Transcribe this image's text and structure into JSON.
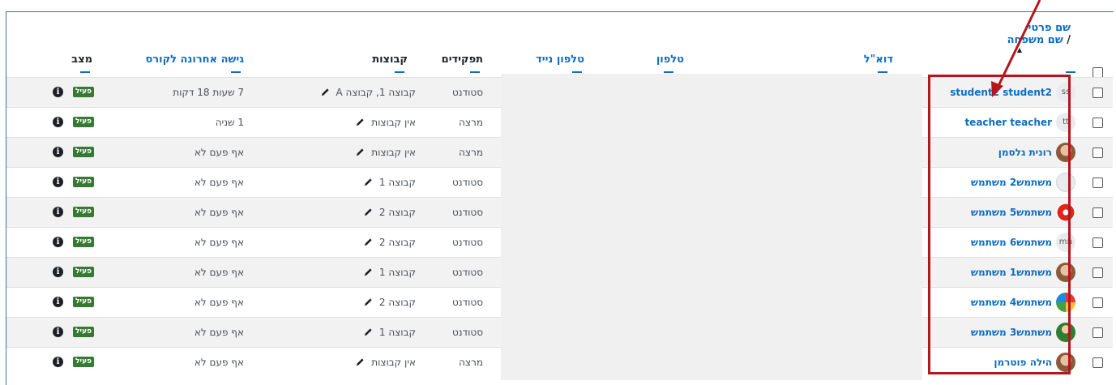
{
  "headers": {
    "name_first": "שם פרטי",
    "name_sep": "/",
    "name_last": "שם משפחה",
    "sort_arrow": "▲",
    "email": "דוא\"ל",
    "phone": "טלפון",
    "mobile": "טלפון נייד",
    "roles": "תפקידים",
    "groups": "קבוצות",
    "last_access": "גישה אחרונה לקורס",
    "status": "מצב"
  },
  "rows": [
    {
      "name": "student2 student2",
      "avatar": "ss",
      "role": "סטודנט",
      "groups": "קבוצה 1, קבוצה A",
      "last_access": "7 שעות 18 דקות",
      "status": "פעיל"
    },
    {
      "name": "teacher teacher",
      "avatar": "tt",
      "role": "מרצה",
      "groups": "אין קבוצות",
      "last_access": "1 שניה",
      "status": "פעיל"
    },
    {
      "name": "רונית גלסמן",
      "avatar": "photo",
      "role": "מרצה",
      "groups": "אין קבוצות",
      "last_access": "אף פעם לא",
      "status": "פעיל"
    },
    {
      "name": "משתמש2 משתמש",
      "avatar": "default",
      "role": "סטודנט",
      "groups": "קבוצה 1",
      "last_access": "אף פעם לא",
      "status": "פעיל"
    },
    {
      "name": "משתמש5 משתמש",
      "avatar": "flower",
      "role": "סטודנט",
      "groups": "קבוצה 2",
      "last_access": "אף פעם לא",
      "status": "פעיל"
    },
    {
      "name": "משתמש6 משתמש",
      "avatar": "מm",
      "role": "סטודנט",
      "groups": "קבוצה 2",
      "last_access": "אף פעם לא",
      "status": "פעיל"
    },
    {
      "name": "משתמש1 משתמש",
      "avatar": "photo",
      "role": "סטודנט",
      "groups": "קבוצה 1",
      "last_access": "אף פעם לא",
      "status": "פעיל"
    },
    {
      "name": "משתמש4 משתמש",
      "avatar": "balloons",
      "role": "סטודנט",
      "groups": "קבוצה 2",
      "last_access": "אף פעם לא",
      "status": "פעיל"
    },
    {
      "name": "משתמש3 משתמש",
      "avatar": "people",
      "role": "סטודנט",
      "groups": "קבוצה 1",
      "last_access": "אף פעם לא",
      "status": "פעיל"
    },
    {
      "name": "הילה פוטרמן",
      "avatar": "photo",
      "role": "מרצה",
      "groups": "אין קבוצות",
      "last_access": "אף פעם לא",
      "status": "פעיל"
    }
  ],
  "icons": {
    "edit": "pencil-icon",
    "info": "info-icon",
    "checkbox": "checkbox"
  },
  "colors": {
    "link": "#0f6cbf",
    "badge": "#357a32",
    "highlight": "#b3171d"
  }
}
